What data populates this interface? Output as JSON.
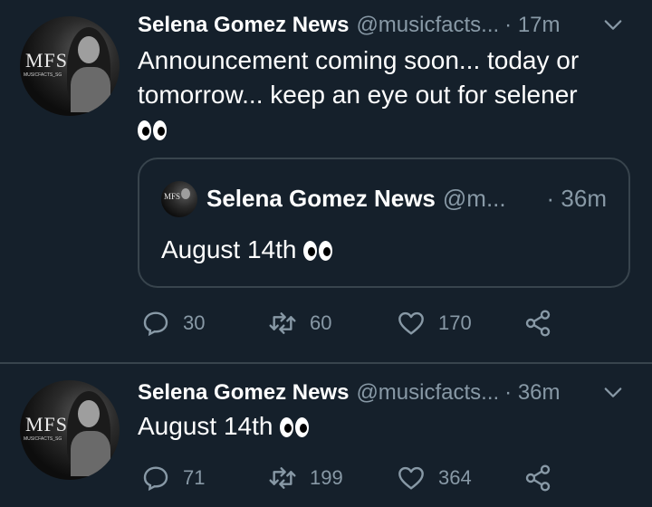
{
  "tweets": [
    {
      "name": "Selena Gomez News",
      "handle": "@musicfacts...",
      "time": "· 17m",
      "text": "Announcement coming soon... today or tomorrow... keep an eye out for selener",
      "avatar_text": "MFS",
      "avatar_subtext": "MUSICFACTS_SG",
      "quote": {
        "name": "Selena Gomez News",
        "handle": "@m...",
        "time": "· 36m",
        "text": "August 14th"
      },
      "stats": {
        "replies": "30",
        "retweets": "60",
        "likes": "170"
      }
    },
    {
      "name": "Selena Gomez News",
      "handle": "@musicfacts...",
      "time": "· 36m",
      "text": "August 14th",
      "avatar_text": "MFS",
      "avatar_subtext": "MUSICFACTS_SG",
      "stats": {
        "replies": "71",
        "retweets": "199",
        "likes": "364"
      }
    }
  ],
  "icons": {
    "reply": "reply-icon",
    "retweet": "retweet-icon",
    "like": "heart-icon",
    "share": "share-icon",
    "menu": "chevron-down-icon",
    "emoji": "eyes-emoji-icon"
  },
  "colors": {
    "background": "#15202b",
    "secondary_text": "#8899a6",
    "border": "#38444d"
  }
}
